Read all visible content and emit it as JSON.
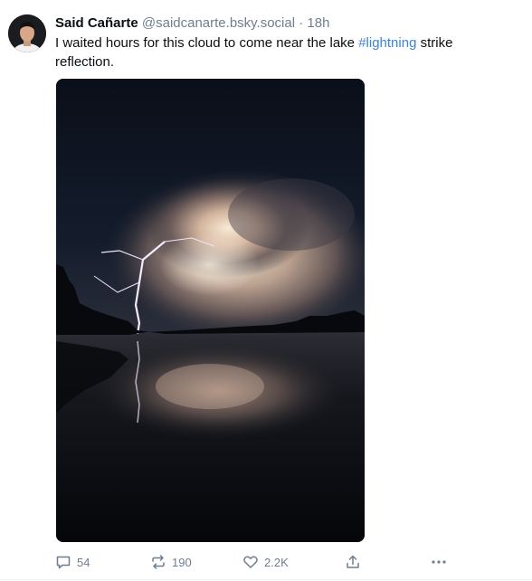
{
  "post": {
    "author_name": "Said Cañarte",
    "author_handle": "@saidcanarte.bsky.social",
    "separator": "·",
    "time_ago": "18h",
    "text_before": "I waited hours for this cloud to come near the lake ",
    "hashtag": "#lightning",
    "text_after": " strike reflection.",
    "image_subject": "night lightning strike over lake with reflection"
  },
  "actions": {
    "reply_count": "54",
    "repost_count": "190",
    "like_count": "2.2K",
    "icons": [
      "reply-icon",
      "repost-icon",
      "like-icon",
      "share-icon",
      "more-icon"
    ]
  },
  "colors": {
    "accent": "#3a84d8",
    "muted": "#6f7e8f",
    "text": "#0b0f14"
  }
}
